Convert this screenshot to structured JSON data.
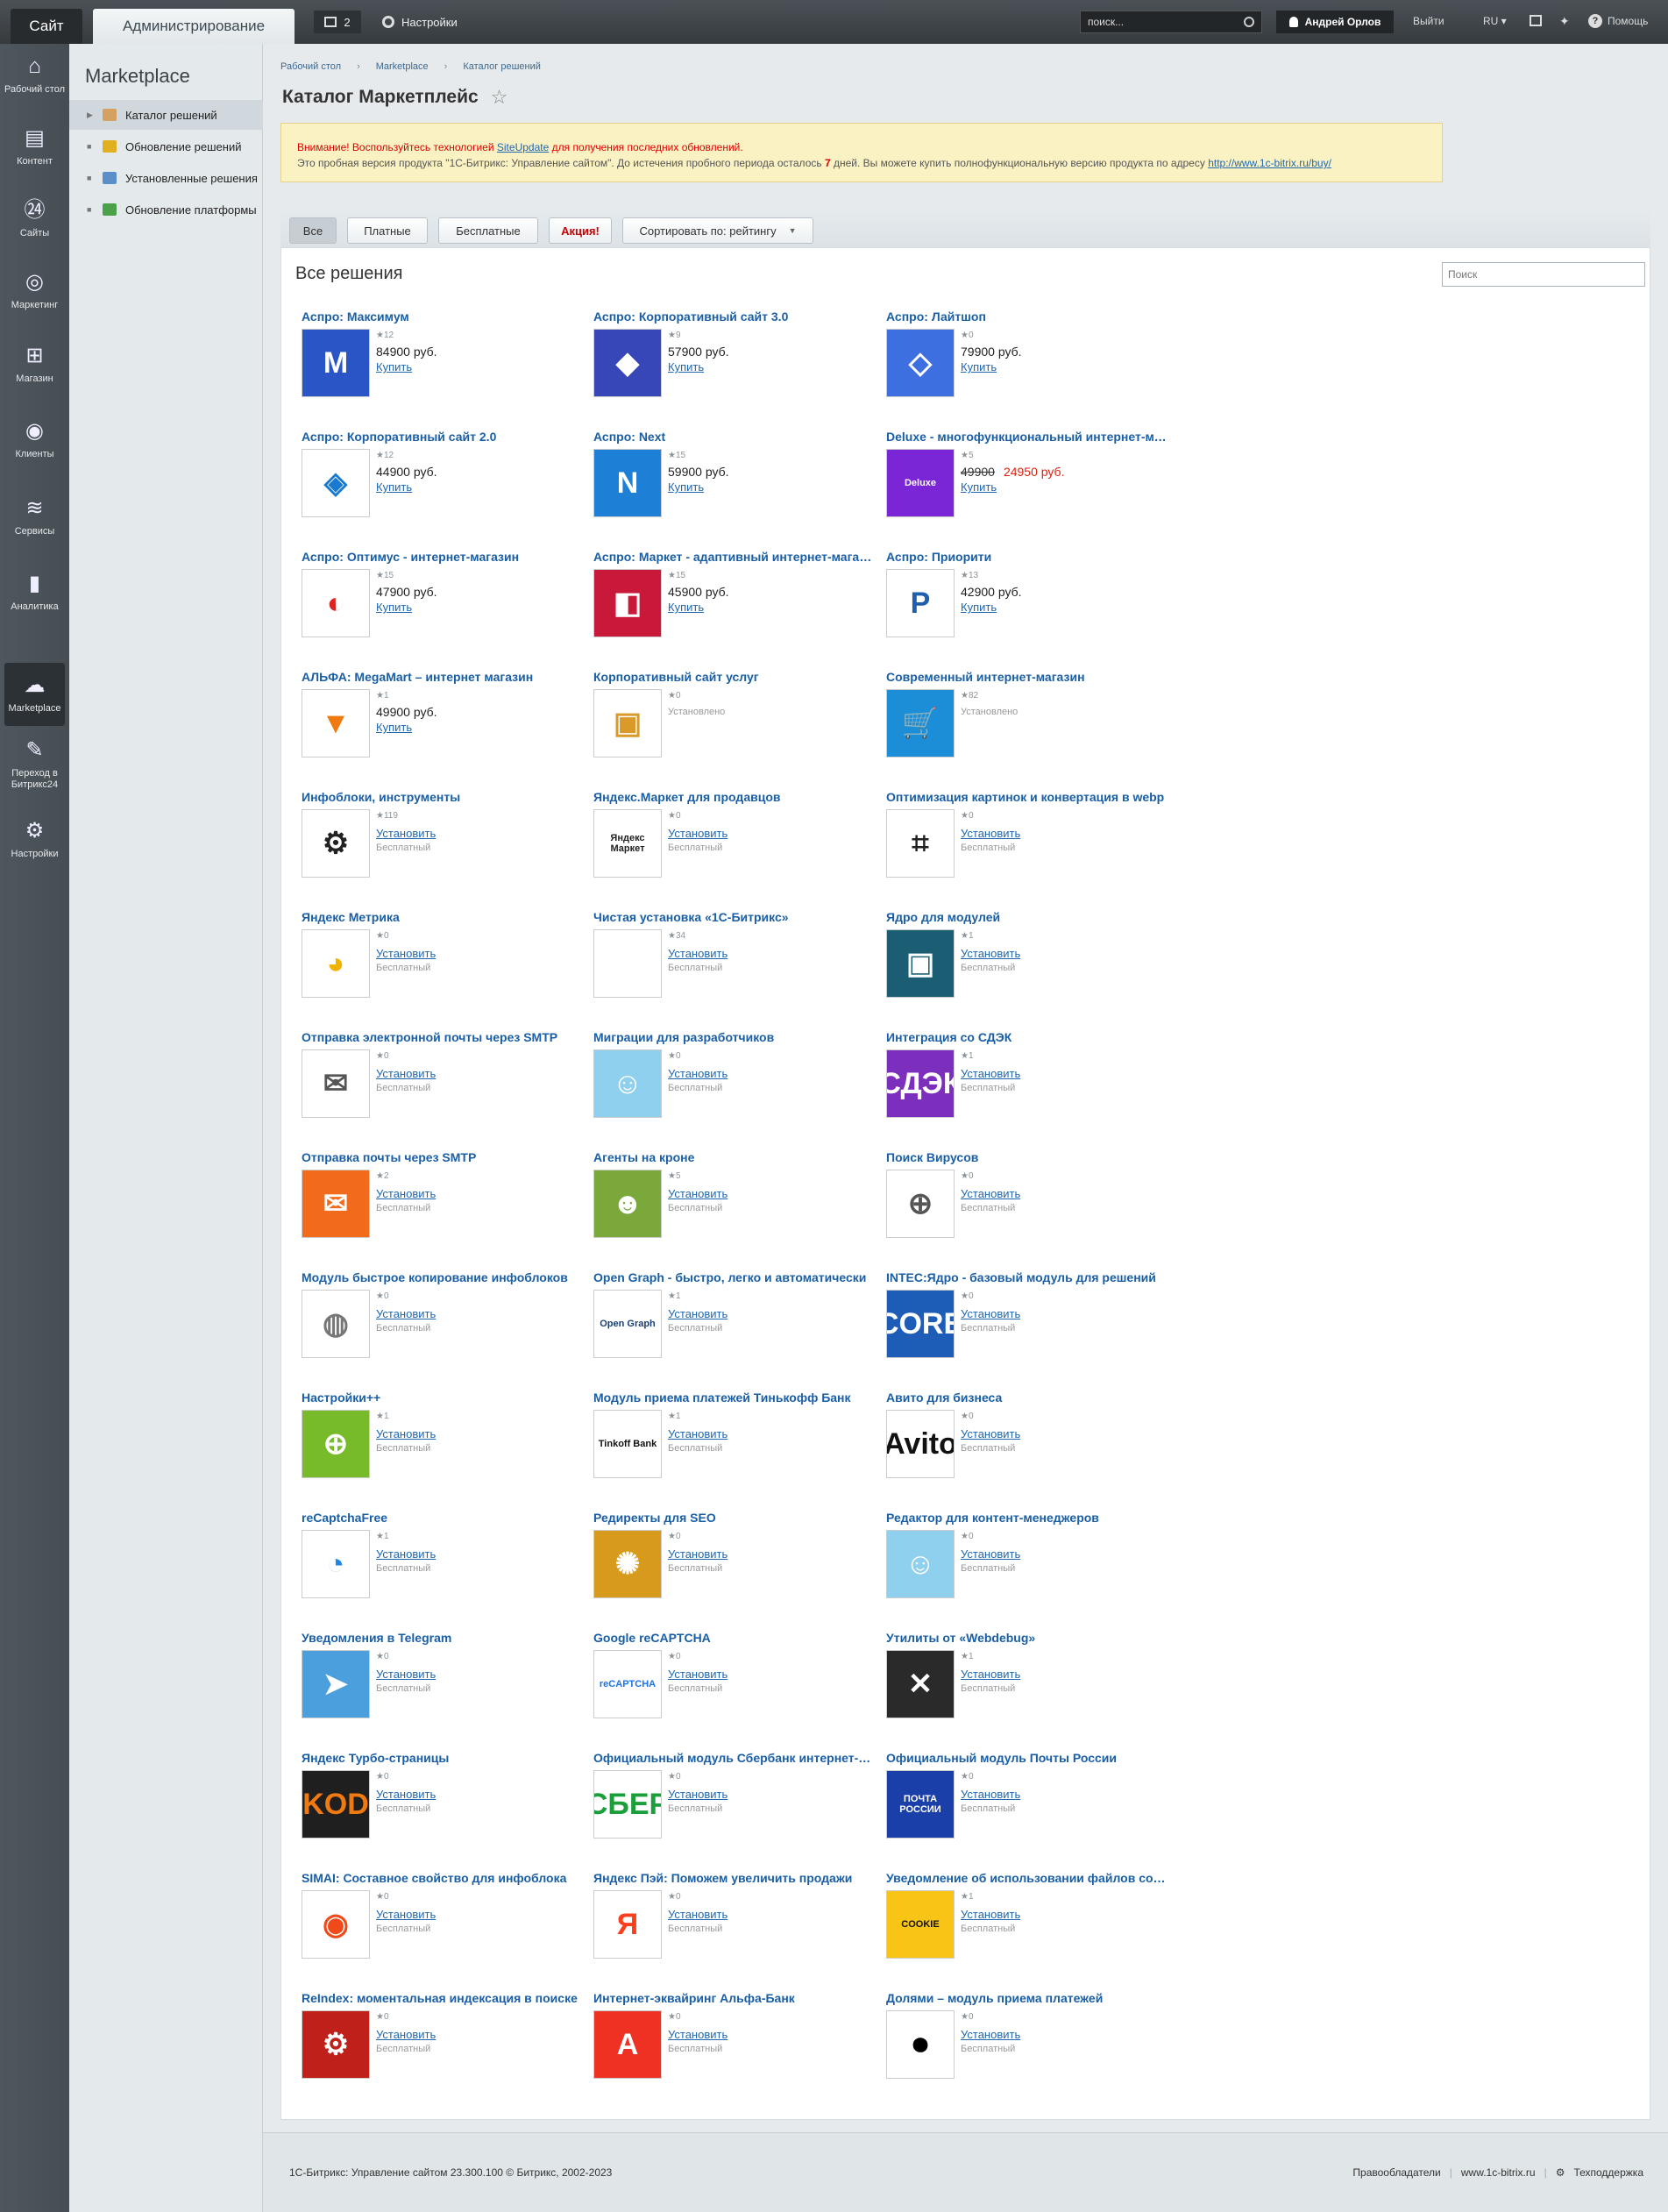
{
  "topbar": {
    "site_tab": "Сайт",
    "admin_tab": "Администрирование",
    "notif_count": "2",
    "settings": "Настройки",
    "search_placeholder": "поиск...",
    "user": "Андрей Орлов",
    "logout": "Выйти",
    "lang": "RU",
    "help": "Помощь"
  },
  "leftnav": [
    {
      "label": "Рабочий стол",
      "icon": "home-icon",
      "glyph": "⌂"
    },
    {
      "label": "Контент",
      "icon": "document-icon",
      "glyph": "▤"
    },
    {
      "label": "Сайты",
      "icon": "sites-24-icon",
      "glyph": "㉔"
    },
    {
      "label": "Маркетинг",
      "icon": "target-icon",
      "glyph": "◎"
    },
    {
      "label": "Магазин",
      "icon": "basket-icon",
      "glyph": "⊞"
    },
    {
      "label": "Клиенты",
      "icon": "clients-icon",
      "glyph": "◉"
    },
    {
      "label": "Сервисы",
      "icon": "layers-icon",
      "glyph": "≋"
    },
    {
      "label": "Аналитика",
      "icon": "bar-chart-icon",
      "glyph": "▮"
    },
    {
      "label": "Marketplace",
      "icon": "cloud-download-icon",
      "glyph": "☁"
    },
    {
      "label": "Переход в Битрикс24",
      "icon": "bitrix24-icon",
      "glyph": "✎"
    },
    {
      "label": "Настройки",
      "icon": "gear-icon",
      "glyph": "⚙"
    }
  ],
  "subnav": {
    "title": "Marketplace",
    "items": [
      {
        "label": "Каталог решений",
        "color": "#d6a060"
      },
      {
        "label": "Обновление решений",
        "color": "#e0b020"
      },
      {
        "label": "Установленные решения",
        "color": "#5b8fc9"
      },
      {
        "label": "Обновление платформы",
        "color": "#4aa14a"
      }
    ]
  },
  "breadcrumb": [
    "Рабочий стол",
    "Marketplace",
    "Каталог решений"
  ],
  "page_title": "Каталог Маркетплейс",
  "warning": {
    "line1_red": "Внимание! Воспользуйтесь технологией",
    "line1_link": "SiteUpdate",
    "line1_red2": "для получения последних обновлений.",
    "line2_a": "Это пробная версия продукта \"1С-Битрикс: Управление сайтом\". До истечения пробного периода осталось",
    "line2_days": "7",
    "line2_b": "дней. Вы можете купить полнофункциональную версию продукта по адресу",
    "line2_link": "http://www.1c-bitrix.ru/buy/"
  },
  "filters": {
    "all": "Все",
    "paid": "Платные",
    "free": "Бесплатные",
    "action": "Акция!",
    "sort": "Сортировать по: рейтингу"
  },
  "panel": {
    "title": "Все решения",
    "search_placeholder": "Поиск"
  },
  "solutions": [
    {
      "name": "Аспро: Максимум",
      "rating": "12",
      "price": "84900 руб.",
      "action": "Купить",
      "logo_bg": "#2a55c7",
      "logo_text": "M"
    },
    {
      "name": "Аспро: Корпоративный сайт 3.0",
      "rating": "9",
      "price": "57900 руб.",
      "action": "Купить",
      "logo_bg": "#3847b8",
      "logo_text": "◆"
    },
    {
      "name": "Аспро: Лайтшоп",
      "rating": "0",
      "price": "79900 руб.",
      "action": "Купить",
      "logo_bg": "#3e6fe0",
      "logo_text": "◇"
    },
    {
      "name": "Аспро: Корпоративный сайт 2.0",
      "rating": "12",
      "price": "44900 руб.",
      "action": "Купить",
      "logo_bg": "#ffffff",
      "logo_text": "◈",
      "logo_fg": "#1a7ad0"
    },
    {
      "name": "Аспро: Next",
      "rating": "15",
      "price": "59900 руб.",
      "action": "Купить",
      "logo_bg": "#1e7fd6",
      "logo_text": "N"
    },
    {
      "name": "Deluxe - многофункциональный интернет-магазин",
      "rating": "5",
      "old_price": "49900",
      "new_price": "24950 руб.",
      "action": "Купить",
      "logo_bg": "#7a25d6",
      "logo_text": "Deluxe"
    },
    {
      "name": "Аспро: Оптимус - интернет-магазин",
      "rating": "15",
      "price": "47900 руб.",
      "action": "Купить",
      "logo_bg": "#ffffff",
      "logo_text": "◐",
      "logo_fg": "#d22"
    },
    {
      "name": "Аспро: Маркет - адаптивный интернет-магазин",
      "rating": "15",
      "price": "45900 руб.",
      "action": "Купить",
      "logo_bg": "#c8193a",
      "logo_text": "◧"
    },
    {
      "name": "Аспро: Приорити",
      "rating": "13",
      "price": "42900 руб.",
      "action": "Купить",
      "logo_bg": "#ffffff",
      "logo_text": "P",
      "logo_fg": "#1f5fb0"
    },
    {
      "name": "АЛЬФА: MegaMart – интернет магазин",
      "rating": "1",
      "price": "49900 руб.",
      "action": "Купить",
      "logo_bg": "#ffffff",
      "logo_text": "▼",
      "logo_fg": "#f07a10"
    },
    {
      "name": "Корпоративный сайт услуг",
      "rating": "0",
      "installed": "Установлено",
      "logo_bg": "#ffffff",
      "logo_text": "▣",
      "logo_fg": "#d99a2a"
    },
    {
      "name": "Современный интернет-магазин",
      "rating": "82",
      "installed": "Установлено",
      "logo_bg": "#1c8ed8",
      "logo_text": "🛒"
    },
    {
      "name": "Инфоблоки, инструменты",
      "rating": "119",
      "action": "Установить",
      "note": "Бесплатный",
      "logo_bg": "#ffffff",
      "logo_text": "⚙",
      "logo_fg": "#222"
    },
    {
      "name": "Яндекс.Маркет для продавцов",
      "rating": "0",
      "action": "Установить",
      "note": "Бесплатный",
      "logo_bg": "#ffffff",
      "logo_text": "Яндекс Маркет",
      "logo_fg": "#222"
    },
    {
      "name": "Оптимизация картинок и конвертация в webp",
      "rating": "0",
      "action": "Установить",
      "note": "Бесплатный",
      "logo_bg": "#ffffff",
      "logo_text": "⌗",
      "logo_fg": "#222"
    },
    {
      "name": "Яндекс Метрика",
      "rating": "0",
      "action": "Установить",
      "note": "Бесплатный",
      "logo_bg": "#ffffff",
      "logo_text": "◕",
      "logo_fg": "#f0b400"
    },
    {
      "name": "Чистая установка «1С-Битрикс»",
      "rating": "34",
      "action": "Установить",
      "note": "Бесплатный",
      "logo_bg": "#ffffff",
      "logo_text": ""
    },
    {
      "name": "Ядро для модулей",
      "rating": "1",
      "action": "Установить",
      "note": "Бесплатный",
      "logo_bg": "#1b5e73",
      "logo_text": "▣"
    },
    {
      "name": "Отправка электронной почты через SMTP",
      "rating": "0",
      "action": "Установить",
      "note": "Бесплатный",
      "logo_bg": "#ffffff",
      "logo_text": "✉",
      "logo_fg": "#555"
    },
    {
      "name": "Миграции для разработчиков",
      "rating": "0",
      "action": "Установить",
      "note": "Бесплатный",
      "logo_bg": "#8fd0ef",
      "logo_text": "☺"
    },
    {
      "name": "Интеграция со СДЭК",
      "rating": "1",
      "action": "Установить",
      "note": "Бесплатный",
      "logo_bg": "#7c2fbd",
      "logo_text": "СДЭК"
    },
    {
      "name": "Отправка почты через SMTP",
      "rating": "2",
      "action": "Установить",
      "note": "Бесплатный",
      "logo_bg": "#f26a1c",
      "logo_text": "✉"
    },
    {
      "name": "Агенты на кроне",
      "rating": "5",
      "action": "Установить",
      "note": "Бесплатный",
      "logo_bg": "#7aa83a",
      "logo_text": "☻"
    },
    {
      "name": "Поиск Вирусов",
      "rating": "0",
      "action": "Установить",
      "note": "Бесплатный",
      "logo_bg": "#ffffff",
      "logo_text": "⊕",
      "logo_fg": "#555"
    },
    {
      "name": "Модуль быстрое копирование инфоблоков",
      "rating": "0",
      "action": "Установить",
      "note": "Бесплатный",
      "logo_bg": "#ffffff",
      "logo_text": "◍",
      "logo_fg": "#777"
    },
    {
      "name": "Open Graph - быстро, легко и автоматически",
      "rating": "1",
      "action": "Установить",
      "note": "Бесплатный",
      "logo_bg": "#ffffff",
      "logo_text": "Open Graph",
      "logo_fg": "#1a3f70"
    },
    {
      "name": "INTEC:Ядро - базовый модуль для решений",
      "rating": "0",
      "action": "Установить",
      "note": "Бесплатный",
      "logo_bg": "#1d5db8",
      "logo_text": "CORE"
    },
    {
      "name": "Настройки++",
      "rating": "1",
      "action": "Установить",
      "note": "Бесплатный",
      "logo_bg": "#77bb2a",
      "logo_text": "⊕"
    },
    {
      "name": "Модуль приема платежей Тинькофф Банк",
      "rating": "1",
      "action": "Установить",
      "note": "Бесплатный",
      "logo_bg": "#ffffff",
      "logo_text": "Tinkoff Bank",
      "logo_fg": "#111"
    },
    {
      "name": "Авито для бизнеса",
      "rating": "0",
      "action": "Установить",
      "note": "Бесплатный",
      "logo_bg": "#ffffff",
      "logo_text": "Avito",
      "logo_fg": "#111"
    },
    {
      "name": "reCaptchaFree",
      "rating": "1",
      "action": "Установить",
      "note": "Бесплатный",
      "logo_bg": "#ffffff",
      "logo_text": "◔",
      "logo_fg": "#1e88e5"
    },
    {
      "name": "Редиректы для SEO",
      "rating": "0",
      "action": "Установить",
      "note": "Бесплатный",
      "logo_bg": "#d79a1c",
      "logo_text": "✺"
    },
    {
      "name": "Редактор для контент-менеджеров",
      "rating": "0",
      "action": "Установить",
      "note": "Бесплатный",
      "logo_bg": "#8fd0ef",
      "logo_text": "☺"
    },
    {
      "name": "Уведомления в Telegram",
      "rating": "0",
      "action": "Установить",
      "note": "Бесплатный",
      "logo_bg": "#4a9fdc",
      "logo_text": "➤"
    },
    {
      "name": "Google reCAPTCHA",
      "rating": "0",
      "action": "Установить",
      "note": "Бесплатный",
      "logo_bg": "#ffffff",
      "logo_text": "reCAPTCHA",
      "logo_fg": "#1a73e8"
    },
    {
      "name": "Утилиты от «Webdebug»",
      "rating": "1",
      "action": "Установить",
      "note": "Бесплатный",
      "logo_bg": "#2a2a2a",
      "logo_text": "✕"
    },
    {
      "name": "Яндекс Турбо-страницы",
      "rating": "0",
      "action": "Установить",
      "note": "Бесплатный",
      "logo_bg": "#1f1f1f",
      "logo_text": "KOD",
      "logo_fg": "#f07a10"
    },
    {
      "name": "Официальный модуль Сбербанк интернет-эквайринг",
      "rating": "0",
      "action": "Установить",
      "note": "Бесплатный",
      "logo_bg": "#ffffff",
      "logo_text": "СБЕР",
      "logo_fg": "#1a9f3a"
    },
    {
      "name": "Официальный модуль Почты России",
      "rating": "0",
      "action": "Установить",
      "note": "Бесплатный",
      "logo_bg": "#1a3fa8",
      "logo_text": "ПОЧТА РОССИИ"
    },
    {
      "name": "SIMAI: Составное свойство для инфоблока",
      "rating": "0",
      "action": "Установить",
      "note": "Бесплатный",
      "logo_bg": "#ffffff",
      "logo_text": "◉",
      "logo_fg": "#f04a1a"
    },
    {
      "name": "Яндекс Пэй: Поможем увеличить продажи",
      "rating": "0",
      "action": "Установить",
      "note": "Бесплатный",
      "logo_bg": "#ffffff",
      "logo_text": "Я",
      "logo_fg": "#fc3f1d"
    },
    {
      "name": "Уведомление об использовании файлов cookie",
      "rating": "1",
      "action": "Установить",
      "note": "Бесплатный",
      "logo_bg": "#f8c516",
      "logo_text": "COOKIE",
      "logo_fg": "#111"
    },
    {
      "name": "ReIndex: моментальная индексация в поиске",
      "rating": "0",
      "action": "Установить",
      "note": "Бесплатный",
      "logo_bg": "#c0201a",
      "logo_text": "⚙"
    },
    {
      "name": "Интернет-эквайринг Альфа-Банк",
      "rating": "0",
      "action": "Установить",
      "note": "Бесплатный",
      "logo_bg": "#ef3124",
      "logo_text": "А"
    },
    {
      "name": "Долями – модуль приема платежей",
      "rating": "0",
      "action": "Установить",
      "note": "Бесплатный",
      "logo_bg": "#ffffff",
      "logo_text": "⏺",
      "logo_fg": "#000"
    }
  ],
  "footer": {
    "left": "1С-Битрикс: Управление сайтом 23.300.100  © Битрикс, 2002-2023",
    "rights": "Правообладатели",
    "site": "www.1c-bitrix.ru",
    "support": "Техподдержка"
  }
}
